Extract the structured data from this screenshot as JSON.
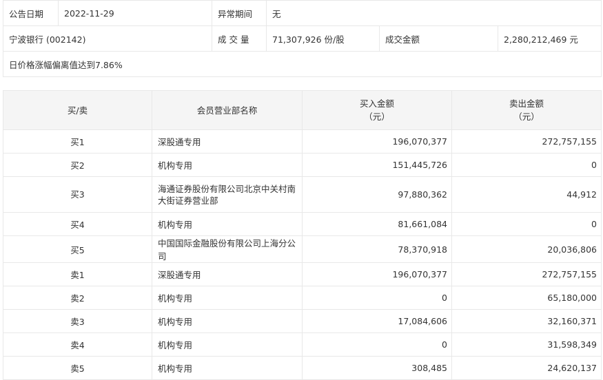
{
  "info": {
    "date_label": "公告日期",
    "date": "2022-11-29",
    "period_label": "异常期间",
    "period": "无",
    "stock": "宁波银行 (002142)",
    "volume_label": "成 交 量",
    "volume": "71,307,926 份/股",
    "amount_label": "成交金额",
    "amount": "2,280,212,469 元",
    "reason": "日价格涨幅偏离值达到7.86%"
  },
  "table": {
    "headers": [
      "买/卖",
      "会员营业部名称",
      "买入金额\n（元）",
      "卖出金额\n（元）"
    ],
    "rows": [
      {
        "side": "买1",
        "name": "深股通专用",
        "buy": "196,070,377",
        "sell": "272,757,155"
      },
      {
        "side": "买2",
        "name": "机构专用",
        "buy": "151,445,726",
        "sell": "0"
      },
      {
        "side": "买3",
        "name": "海通证券股份有限公司北京中关村南大街证券营业部",
        "buy": "97,880,362",
        "sell": "44,912"
      },
      {
        "side": "买4",
        "name": "机构专用",
        "buy": "81,661,084",
        "sell": "0"
      },
      {
        "side": "买5",
        "name": "中国国际金融股份有限公司上海分公司",
        "buy": "78,370,918",
        "sell": "20,036,806"
      },
      {
        "side": "卖1",
        "name": "深股通专用",
        "buy": "196,070,377",
        "sell": "272,757,155"
      },
      {
        "side": "卖2",
        "name": "机构专用",
        "buy": "0",
        "sell": "65,180,000"
      },
      {
        "side": "卖3",
        "name": "机构专用",
        "buy": "17,084,606",
        "sell": "32,160,371"
      },
      {
        "side": "卖4",
        "name": "机构专用",
        "buy": "0",
        "sell": "31,598,349"
      },
      {
        "side": "卖5",
        "name": "机构专用",
        "buy": "308,485",
        "sell": "24,620,137"
      }
    ]
  }
}
